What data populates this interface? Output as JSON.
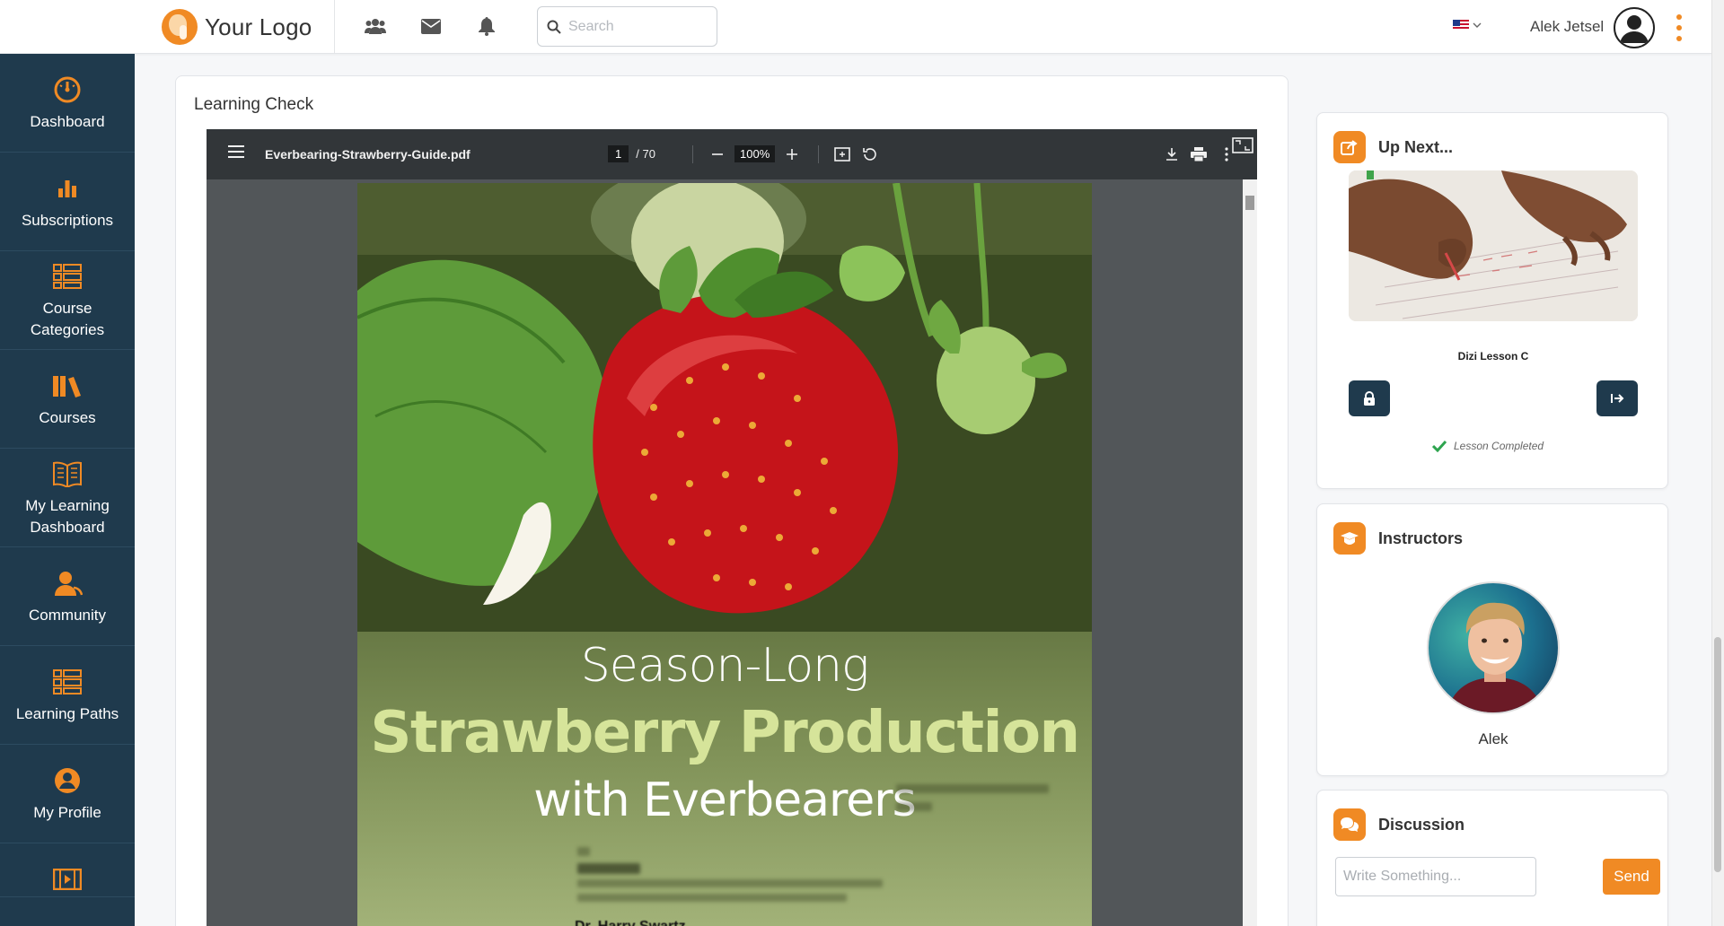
{
  "header": {
    "logo_text": "Your Logo",
    "search_placeholder": "Search",
    "language_flag": "us-flag",
    "user_name": "Alek Jetsel",
    "icons": [
      "users-icon",
      "mail-icon",
      "bell-icon"
    ]
  },
  "sidebar": {
    "items": [
      {
        "label": "Dashboard",
        "icon": "dashboard-gauge-icon"
      },
      {
        "label": "Subscriptions",
        "icon": "bar-chart-icon"
      },
      {
        "label": "Course\nCategories",
        "icon": "list-icon"
      },
      {
        "label": "Courses",
        "icon": "books-icon"
      },
      {
        "label": "My Learning\nDashboard",
        "icon": "open-book-icon"
      },
      {
        "label": "Community",
        "icon": "community-icon"
      },
      {
        "label": "Learning Paths",
        "icon": "list-icon"
      },
      {
        "label": "My Profile",
        "icon": "user-circle-icon"
      }
    ]
  },
  "main": {
    "title": "Learning Check",
    "pdf": {
      "filename": "Everbearing-Strawberry-Guide.pdf",
      "current_page": "1",
      "total_pages": "/ 70",
      "zoom": "100%",
      "document": {
        "line1": "Season-Long",
        "line2": "Strawberry Production",
        "line3": "with Everbearers",
        "author": "Dr. Harry Swartz"
      }
    }
  },
  "upnext": {
    "title": "Up Next...",
    "lesson_title": "Dizi Lesson C",
    "status": "Lesson Completed"
  },
  "instructors": {
    "title": "Instructors",
    "name": "Alek"
  },
  "discussion": {
    "title": "Discussion",
    "input_placeholder": "Write Something...",
    "send_label": "Send"
  },
  "colors": {
    "accent": "#f08a24",
    "sidebar_bg": "#1f3a4d",
    "success": "#2ea44f"
  }
}
